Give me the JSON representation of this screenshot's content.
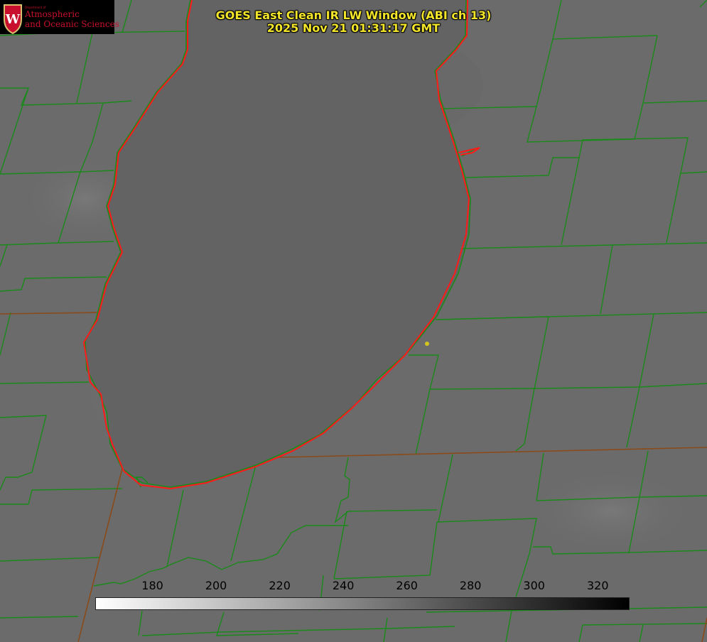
{
  "title": {
    "line1": "GOES East Clean IR LW Window (ABI ch 13)",
    "line2": "2025 Nov 21 01:31:17 GMT"
  },
  "logo": {
    "department": "Department of",
    "line1": "Atmospheric",
    "line2": "and Oceanic Sciences",
    "emblem": "W"
  },
  "colorbar": {
    "ticks": [
      "180",
      "200",
      "220",
      "240",
      "260",
      "280",
      "300",
      "320"
    ],
    "range": [
      162,
      330
    ],
    "gradient": [
      "#ffffff",
      "#000000"
    ]
  },
  "colors": {
    "county_lines": "#1a8a1a",
    "state_lines": "#8a4a1a",
    "coastline": "#ff1a1a",
    "title_text": "#f2e52a",
    "logo_text": "#c8102e",
    "marker": "#d4c420"
  }
}
